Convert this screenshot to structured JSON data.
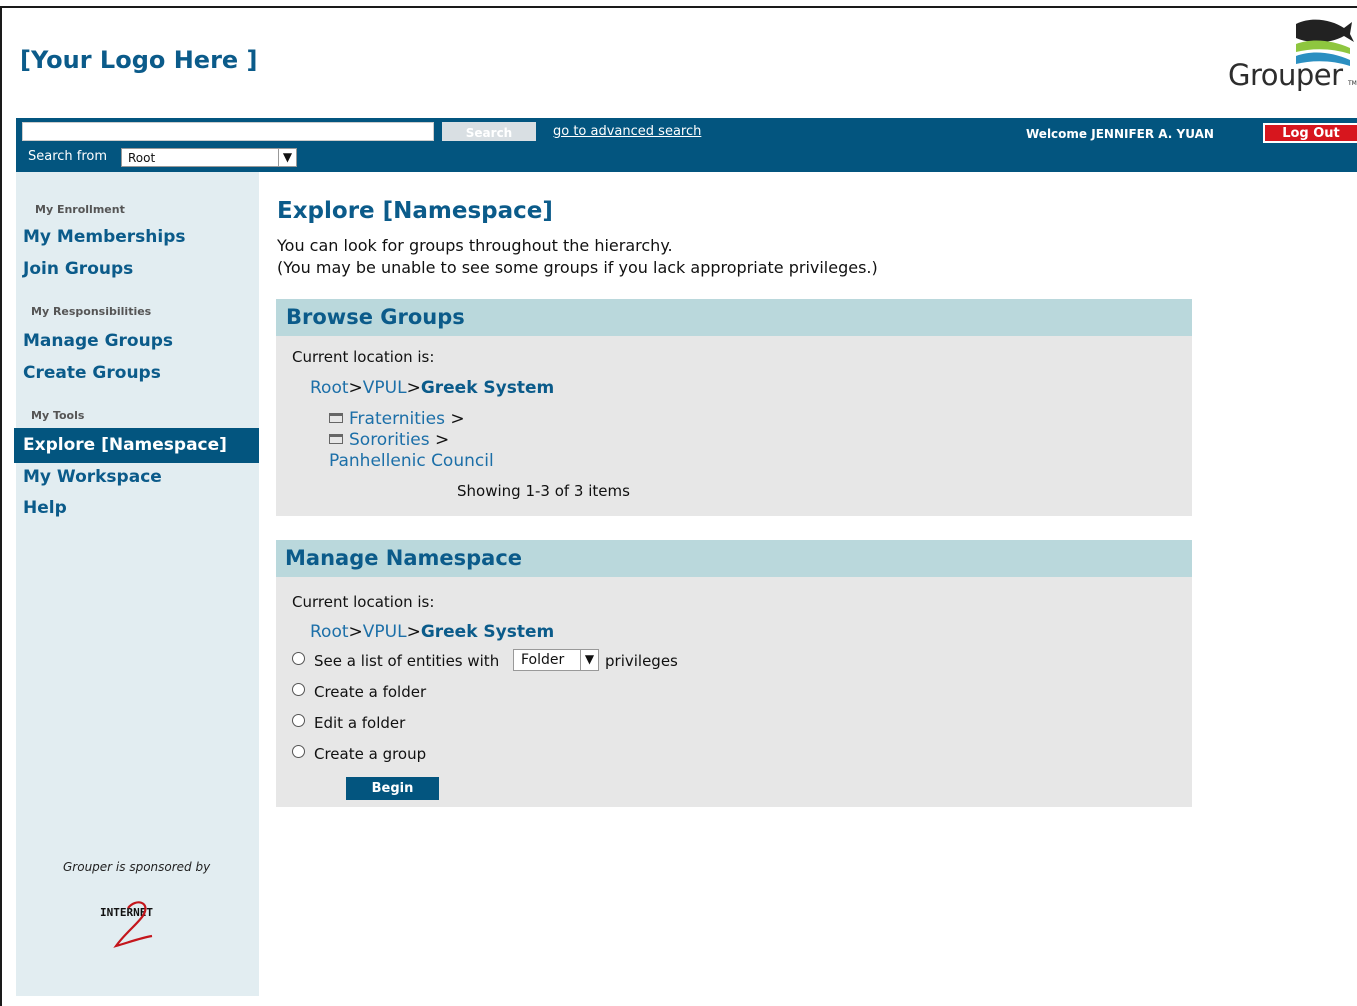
{
  "header": {
    "logo_text": "[Your Logo Here ]",
    "brand": "Grouper",
    "brand_tm": "TM"
  },
  "topbar": {
    "search_value": "",
    "search_button": "Search",
    "advanced_link": "go to advanced search",
    "search_from_label": "Search from",
    "search_from_value": "Root",
    "welcome": "Welcome JENNIFER A. YUAN",
    "logout": "Log Out"
  },
  "sidebar": {
    "sections": [
      {
        "label": "My Enrollment",
        "items": [
          "My Memberships",
          "Join Groups"
        ]
      },
      {
        "label": "My Responsibilities",
        "items": [
          "Manage Groups",
          "Create Groups"
        ]
      },
      {
        "label": "My Tools",
        "items": [
          "Explore [Namespace]",
          "My Workspace",
          "Help"
        ]
      }
    ],
    "active": "Explore [Namespace]",
    "sponsor_text": "Grouper is sponsored by",
    "sponsor_logo": "INTERNET"
  },
  "main": {
    "title": "Explore [Namespace]",
    "intro_line1": "You can look for groups throughout the hierarchy.",
    "intro_line2": "(You may be unable to see some groups if you lack appropriate privileges.)"
  },
  "browse": {
    "title": "Browse Groups",
    "location_label": "Current location is:",
    "crumb_root": "Root",
    "crumb_vpul": "VPUL",
    "crumb_current": "Greek System",
    "separator": ">",
    "items": [
      {
        "label": "Fraternities",
        "suffix": ">",
        "folder": true
      },
      {
        "label": "Sororities",
        "suffix": ">",
        "folder": true
      },
      {
        "label": "Panhellenic Council",
        "suffix": "",
        "folder": false
      }
    ],
    "showing": "Showing 1-3 of 3 items"
  },
  "manage": {
    "title": "Manage Namespace",
    "location_label": "Current location is:",
    "crumb_root": "Root",
    "crumb_vpul": "VPUL",
    "crumb_current": "Greek System",
    "separator": ">",
    "option1_before": "See a list of entities with",
    "option1_select": "Folder",
    "option1_after": "privileges",
    "option2": "Create a folder",
    "option3": "Edit a folder",
    "option4": "Create a group",
    "begin_button": "Begin"
  },
  "colors": {
    "primary": "#03557f",
    "link": "#1c6fa8",
    "panel_header": "#bad8dc",
    "panel_body": "#e7e7e7",
    "sidebar": "#e2edf1",
    "logout": "#d7161e"
  }
}
